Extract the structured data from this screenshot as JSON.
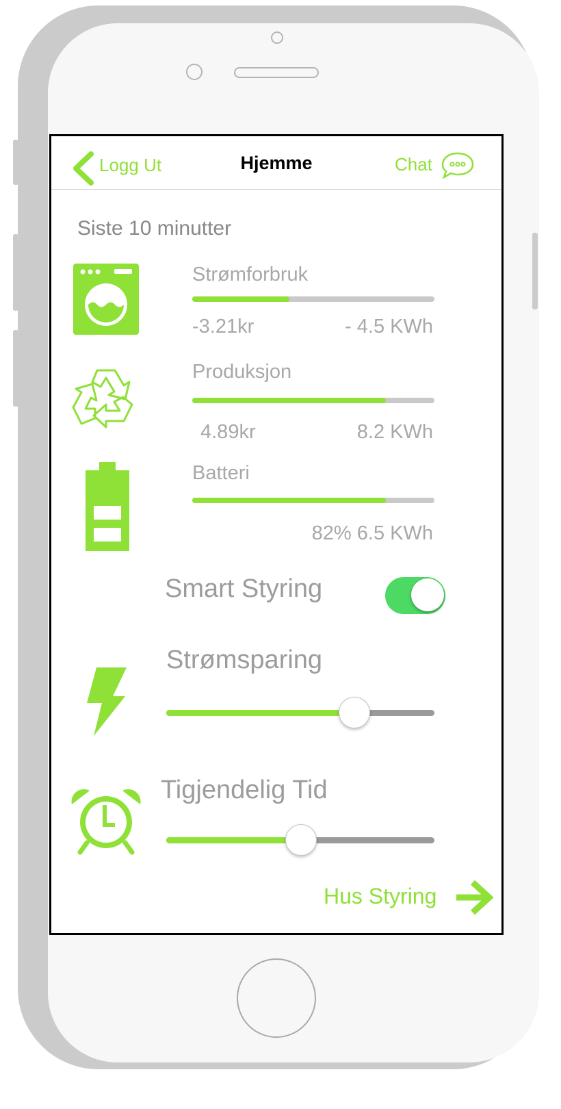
{
  "nav": {
    "back_label": "Logg Ut",
    "title": "Hjemme",
    "chat_label": "Chat"
  },
  "period_label": "Siste 10 minutter",
  "metrics": [
    {
      "label": "Strømforbruk",
      "fill_fraction": 0.4,
      "left_value": "-3.21kr",
      "right_value": "- 4.5 KWh",
      "icon": "washing-machine-icon"
    },
    {
      "label": "Produksjon",
      "fill_fraction": 0.8,
      "left_value": "4.89kr",
      "right_value": "8.2 KWh",
      "icon": "recycle-icon"
    },
    {
      "label": "Batteri",
      "fill_fraction": 0.8,
      "right_value": "82% 6.5 KWh",
      "icon": "battery-icon"
    }
  ],
  "smart": {
    "label": "Smart Styring",
    "on": true
  },
  "saving": {
    "label": "Strømsparing",
    "value_fraction": 0.7,
    "icon": "lightning-icon"
  },
  "time": {
    "label": "Tigjendelig Tid",
    "value_fraction": 0.5,
    "icon": "alarm-clock-icon"
  },
  "footer": {
    "link_label": "Hus Styring"
  },
  "colors": {
    "accent": "#8fe037",
    "toggle_on": "#4cd964",
    "text_muted": "#a8a8a8"
  }
}
